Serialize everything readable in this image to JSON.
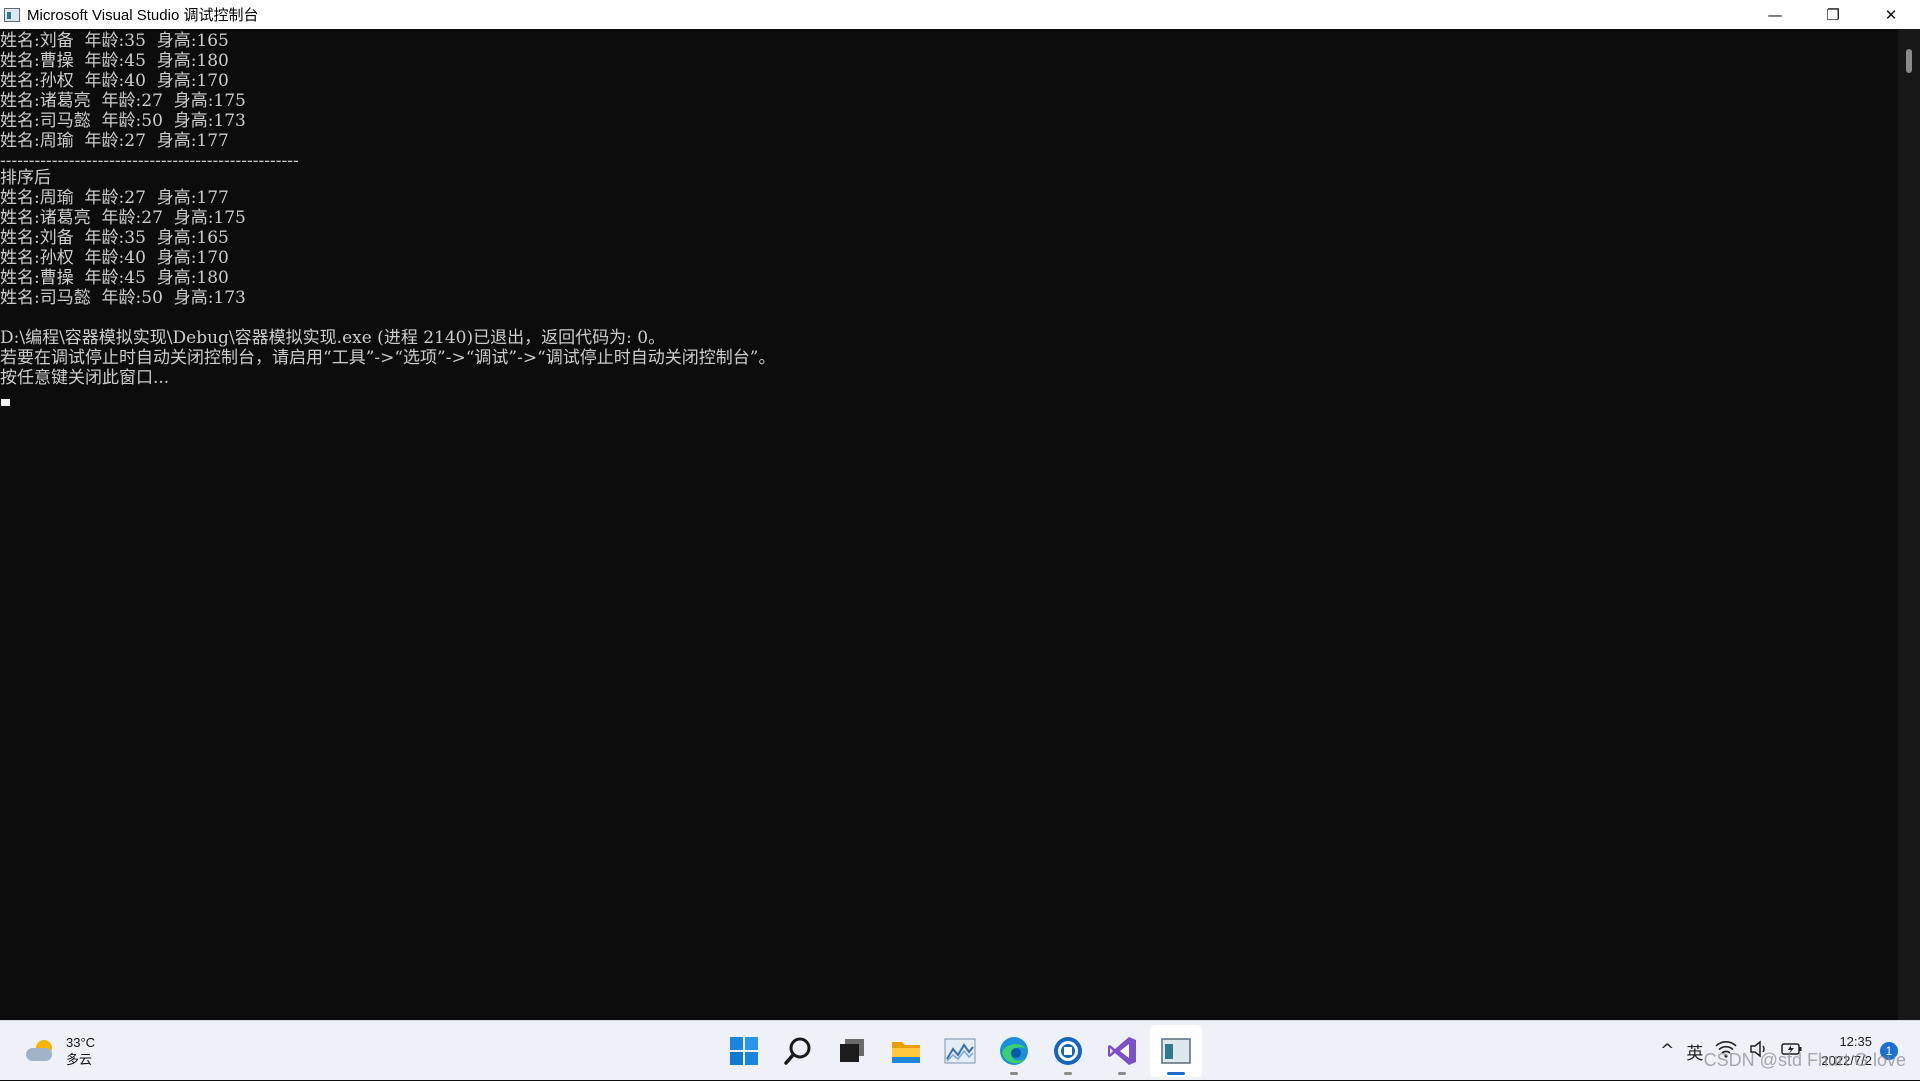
{
  "window": {
    "title": "Microsoft Visual Studio 调试控制台",
    "controls": {
      "minimize": "—",
      "restore": "❐",
      "close": "✕"
    }
  },
  "console": {
    "lines": [
      "姓名:刘备  年龄:35  身高:165",
      "姓名:曹操  年龄:45  身高:180",
      "姓名:孙权  年龄:40  身高:170",
      "姓名:诸葛亮  年龄:27  身高:175",
      "姓名:司马懿  年龄:50  身高:173",
      "姓名:周瑜  年龄:27  身高:177",
      "----------------------------------------------------",
      "",
      "排序后",
      "姓名:周瑜  年龄:27  身高:177",
      "姓名:诸葛亮  年龄:27  身高:175",
      "姓名:刘备  年龄:35  身高:165",
      "姓名:孙权  年龄:40  身高:170",
      "姓名:曹操  年龄:45  身高:180",
      "姓名:司马懿  年龄:50  身高:173",
      "",
      "D:\\编程\\容器模拟实现\\Debug\\容器模拟实现.exe (进程 2140)已退出，返回代码为: 0。",
      "若要在调试停止时自动关闭控制台，请启用“工具”->“选项”->“调试”->“调试停止时自动关闭控制台”。",
      "按任意键关闭此窗口..."
    ]
  },
  "taskbar": {
    "weather": {
      "temperature": "33°C",
      "condition": "多云"
    },
    "icons": [
      {
        "name": "start-icon",
        "label": "Start"
      },
      {
        "name": "search-icon",
        "label": "Search"
      },
      {
        "name": "task-view-icon",
        "label": "Task View"
      },
      {
        "name": "file-explorer-icon",
        "label": "File Explorer"
      },
      {
        "name": "chart-app-icon",
        "label": "App"
      },
      {
        "name": "edge-icon",
        "label": "Microsoft Edge"
      },
      {
        "name": "app-icon",
        "label": "App"
      },
      {
        "name": "visual-studio-icon",
        "label": "Visual Studio"
      },
      {
        "name": "console-icon",
        "label": "Debug Console"
      }
    ],
    "tray": {
      "chevron": "^",
      "ime": "英",
      "time": "12:35",
      "date": "2022/7/2",
      "notifications": "1"
    }
  },
  "watermark": "CSDN @std Fhurt G love",
  "colors": {
    "console_bg": "#0c0c0c",
    "console_text": "#cccccc",
    "accent": "#1a6fd1"
  }
}
